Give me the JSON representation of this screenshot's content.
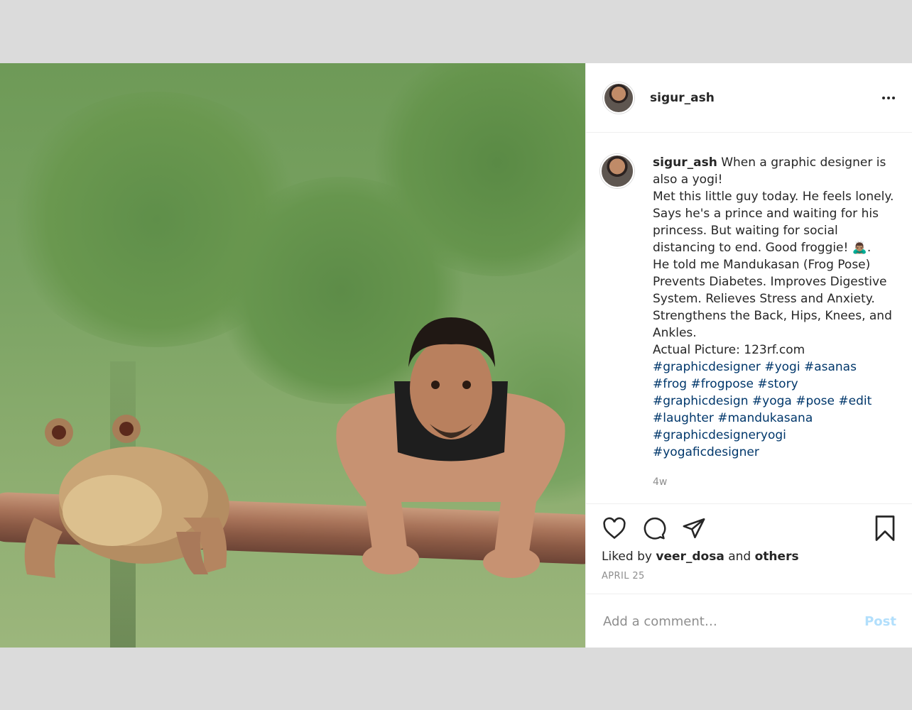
{
  "post": {
    "username": "sigur_ash",
    "menu_icon": "more-horizontal-icon",
    "photo": {
      "description_icon": "image",
      "scene_colors": {
        "background": "#76a05f",
        "branch": "#a9745a",
        "frog": "#c9a576",
        "shirt": "#1e1e1e"
      }
    },
    "caption": {
      "username": "sigur_ash",
      "lines": [
        "When a graphic designer is also a yogi!",
        "Met this little guy today. He feels lonely. Says he's a prince and waiting for his princess. But waiting for social distancing to end. Good froggie! 🙇🏽‍♂️.",
        "He told me Mandukasan (Frog Pose) Prevents Diabetes. Improves Digestive System. Relieves Stress and Anxiety. Strengthens the Back, Hips, Knees, and Ankles.",
        "Actual Picture: 123rf.com"
      ],
      "hashtags": [
        "#graphicdesigner",
        "#yogi",
        "#asanas",
        "#frog",
        "#frogpose",
        "#story",
        "#graphicdesign",
        "#yoga",
        "#pose",
        "#edit",
        "#laughter",
        "#mandukasana",
        "#graphicdesigneryogi",
        "#yogaficdesigner"
      ],
      "time": "4w"
    },
    "actions": {
      "like_icon": "heart-icon",
      "comment_icon": "comment-icon",
      "share_icon": "send-icon",
      "save_icon": "bookmark-icon"
    },
    "likes": {
      "prefix": "Liked by",
      "user": "veer_dosa",
      "middle": "and",
      "others": "others"
    },
    "date": "APRIL 25",
    "comment_box": {
      "placeholder": "Add a comment…",
      "post_label": "Post"
    },
    "colors": {
      "link": "#00376b",
      "muted": "#8e8e8e",
      "post_button": "#b2dffc"
    }
  }
}
